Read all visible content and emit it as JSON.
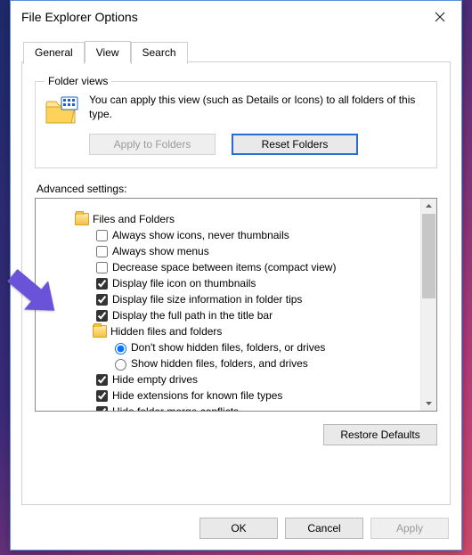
{
  "window": {
    "title": "File Explorer Options"
  },
  "tabs": {
    "general": "General",
    "view": "View",
    "search": "Search"
  },
  "folderViews": {
    "legend": "Folder views",
    "text": "You can apply this view (such as Details or Icons) to all folders of this type.",
    "applyBtn": "Apply to Folders",
    "resetBtn": "Reset Folders"
  },
  "advanced": {
    "label": "Advanced settings:",
    "root": "Files and Folders",
    "items": [
      {
        "type": "check",
        "checked": false,
        "label": "Always show icons, never thumbnails"
      },
      {
        "type": "check",
        "checked": false,
        "label": "Always show menus"
      },
      {
        "type": "check",
        "checked": false,
        "label": "Decrease space between items (compact view)"
      },
      {
        "type": "check",
        "checked": true,
        "label": "Display file icon on thumbnails"
      },
      {
        "type": "check",
        "checked": true,
        "label": "Display file size information in folder tips"
      },
      {
        "type": "check",
        "checked": true,
        "label": "Display the full path in the title bar"
      },
      {
        "type": "folder",
        "label": "Hidden files and folders"
      },
      {
        "type": "radio",
        "checked": true,
        "label": "Don't show hidden files, folders, or drives"
      },
      {
        "type": "radio",
        "checked": false,
        "label": "Show hidden files, folders, and drives"
      },
      {
        "type": "check",
        "checked": true,
        "label": "Hide empty drives"
      },
      {
        "type": "check",
        "checked": true,
        "label": "Hide extensions for known file types"
      },
      {
        "type": "check",
        "checked": true,
        "label": "Hide folder merge conflicts"
      }
    ]
  },
  "buttons": {
    "restore": "Restore Defaults",
    "ok": "OK",
    "cancel": "Cancel",
    "apply": "Apply"
  }
}
